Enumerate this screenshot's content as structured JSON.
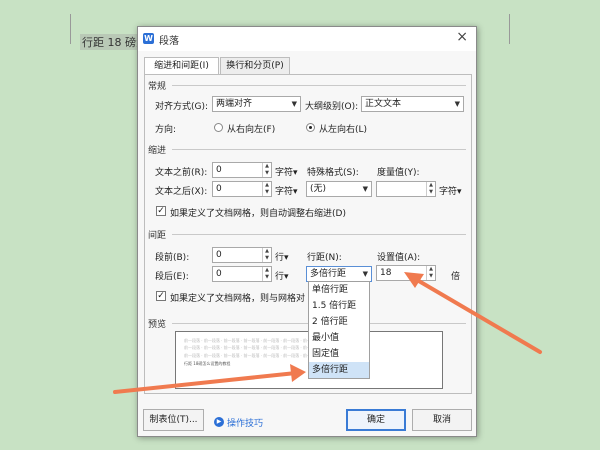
{
  "document": {
    "text": "行距 18 磅怎"
  },
  "dialog": {
    "title": "段落",
    "logo": "W",
    "close": "×",
    "tabs": [
      "缩进和间距(I)",
      "换行和分页(P)"
    ]
  },
  "general": {
    "header": "常规",
    "alignment_label": "对齐方式(G):",
    "alignment_value": "两端对齐",
    "outline_label": "大纲级别(O):",
    "outline_value": "正文文本",
    "direction_label": "方向:",
    "rtl_label": "从右向左(F)",
    "ltr_label": "从左向右(L)"
  },
  "indent": {
    "header": "缩进",
    "before_label": "文本之前(R):",
    "before_value": "0",
    "before_unit": "字符▾",
    "after_label": "文本之后(X):",
    "after_value": "0",
    "after_unit": "字符▾",
    "special_label": "特殊格式(S):",
    "special_value": "(无)",
    "measure_label": "度量值(Y):",
    "measure_value": "",
    "measure_unit": "字符▾",
    "auto_adjust": "如果定义了文档网格，则自动调整右缩进(D)"
  },
  "spacing": {
    "header": "间距",
    "before_label": "段前(B):",
    "before_value": "0",
    "before_unit": "行▾",
    "after_label": "段后(E):",
    "after_value": "0",
    "after_unit": "行▾",
    "line_label": "行距(N):",
    "line_value": "多倍行距",
    "setting_label": "设置值(A):",
    "setting_value": "18",
    "setting_unit": "倍",
    "snap_grid": "如果定义了文档网格，则与网格对",
    "line_options": [
      "单倍行距",
      "1.5 倍行距",
      "2 倍行距",
      "最小值",
      "固定值",
      "多倍行距"
    ]
  },
  "preview": {
    "header": "预览",
    "sample_prev": "前一段落 · 前一段落 · 前一段落 · 前一段落 · 前一段落 · 前一段落 · 前一段落 · 前一段落 · 前一段落",
    "sample_text": "行距 18磅怎么设置的教程"
  },
  "buttons": {
    "tabs_button": "制表位(T)...",
    "tips": "操作技巧",
    "ok": "确定",
    "cancel": "取消"
  },
  "colors": {
    "arrow": "#f07a4f",
    "accent": "#2b6fd6",
    "background": "#c8e2c4"
  }
}
